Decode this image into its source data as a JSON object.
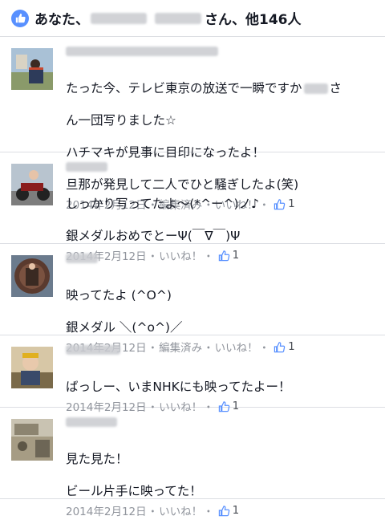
{
  "header": {
    "prefix": "あなた、",
    "suffix": "さん、他146人"
  },
  "comments": [
    {
      "lines": [
        "たった今、テレビ東京の放送で一瞬ですか",
        "ん一団写りました☆",
        "ハチマキが見事に目印になったよ！",
        "旦那が発見して二人でひと騒ぎしたよ(笑)"
      ],
      "text_after_blur": "さ",
      "date": "2014年2月12日",
      "edited": "編集済み",
      "like_label": "いいね！",
      "likes": "1"
    },
    {
      "lines": [
        "しっかり写ってたよ〜(*^ー^)ノ♪",
        "銀メダルおめでとーΨ(￣∇￣)Ψ"
      ],
      "date": "2014年2月12日",
      "like_label": "いいね！",
      "likes": "1"
    },
    {
      "lines": [
        "映ってたよ (^O^)",
        "銀メダル ＼(^o^)／"
      ],
      "date": "2014年2月12日",
      "edited": "編集済み",
      "like_label": "いいね！",
      "likes": "1"
    },
    {
      "lines": [
        "ばっしー、いまNHKにも映ってたよー！"
      ],
      "date": "2014年2月12日",
      "like_label": "いいね！",
      "likes": "1"
    },
    {
      "lines": [
        "見た見た！",
        "ビール片手に映ってた！"
      ],
      "date": "2014年2月12日",
      "like_label": "いいね！",
      "likes": "1"
    }
  ],
  "colors": {
    "like_blue": "#5890ff",
    "meta_gray": "#90949c"
  },
  "icons": {
    "header": "like-thumb-icon",
    "meta": "thumb-up-icon"
  }
}
